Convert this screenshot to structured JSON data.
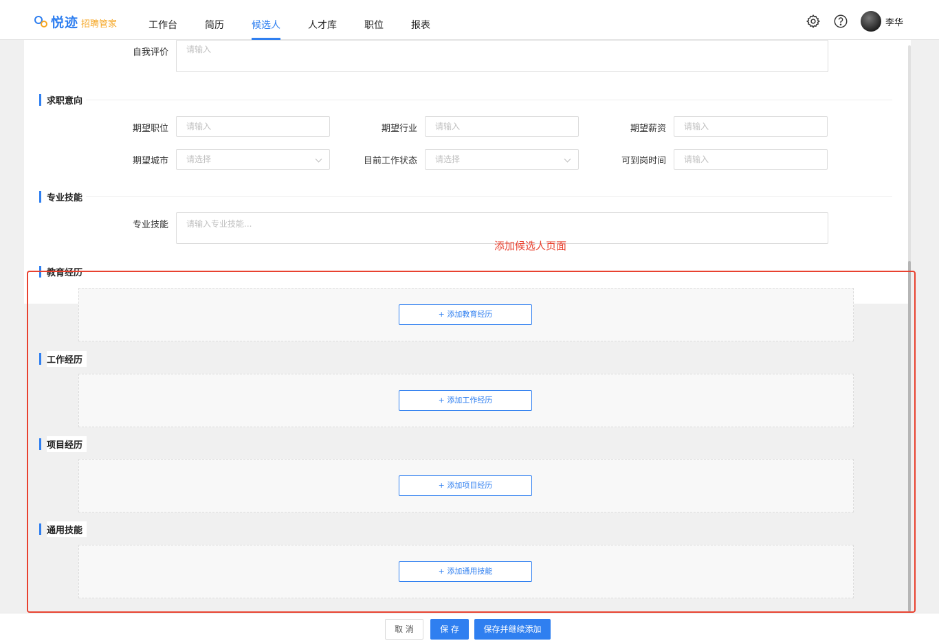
{
  "brand": {
    "name": "悦迹",
    "sub": "招聘管家"
  },
  "nav": [
    "工作台",
    "简历",
    "候选人",
    "人才库",
    "职位",
    "报表"
  ],
  "user": {
    "name": "李华"
  },
  "self_eval": {
    "label": "自我评价",
    "placeholder": "请输入"
  },
  "intent": {
    "title": "求职意向",
    "fields": [
      {
        "label": "期望职位",
        "placeholder": "请输入"
      },
      {
        "label": "期望行业",
        "placeholder": "请输入"
      },
      {
        "label": "期望薪资",
        "placeholder": "请输入"
      },
      {
        "label": "期望城市",
        "placeholder": "请选择"
      },
      {
        "label": "目前工作状态",
        "placeholder": "请选择"
      },
      {
        "label": "可到岗时间",
        "placeholder": "请输入"
      }
    ]
  },
  "skills": {
    "title": "专业技能",
    "label": "专业技能",
    "placeholder": "请输入专业技能..."
  },
  "annotation": "添加候选人页面",
  "sections": [
    {
      "title": "教育经历",
      "button": "+ 添加教育经历"
    },
    {
      "title": "工作经历",
      "button": "+ 添加工作经历"
    },
    {
      "title": "项目经历",
      "button": "+ 添加项目经历"
    },
    {
      "title": "通用技能",
      "button": "+ 添加通用技能"
    }
  ],
  "footer": {
    "cancel": "取 消",
    "save": "保 存",
    "save_continue": "保存并继续添加"
  },
  "colors": {
    "primary": "#2f7ff0",
    "annotation": "#e8412f",
    "brand_accent": "#f5a623"
  }
}
